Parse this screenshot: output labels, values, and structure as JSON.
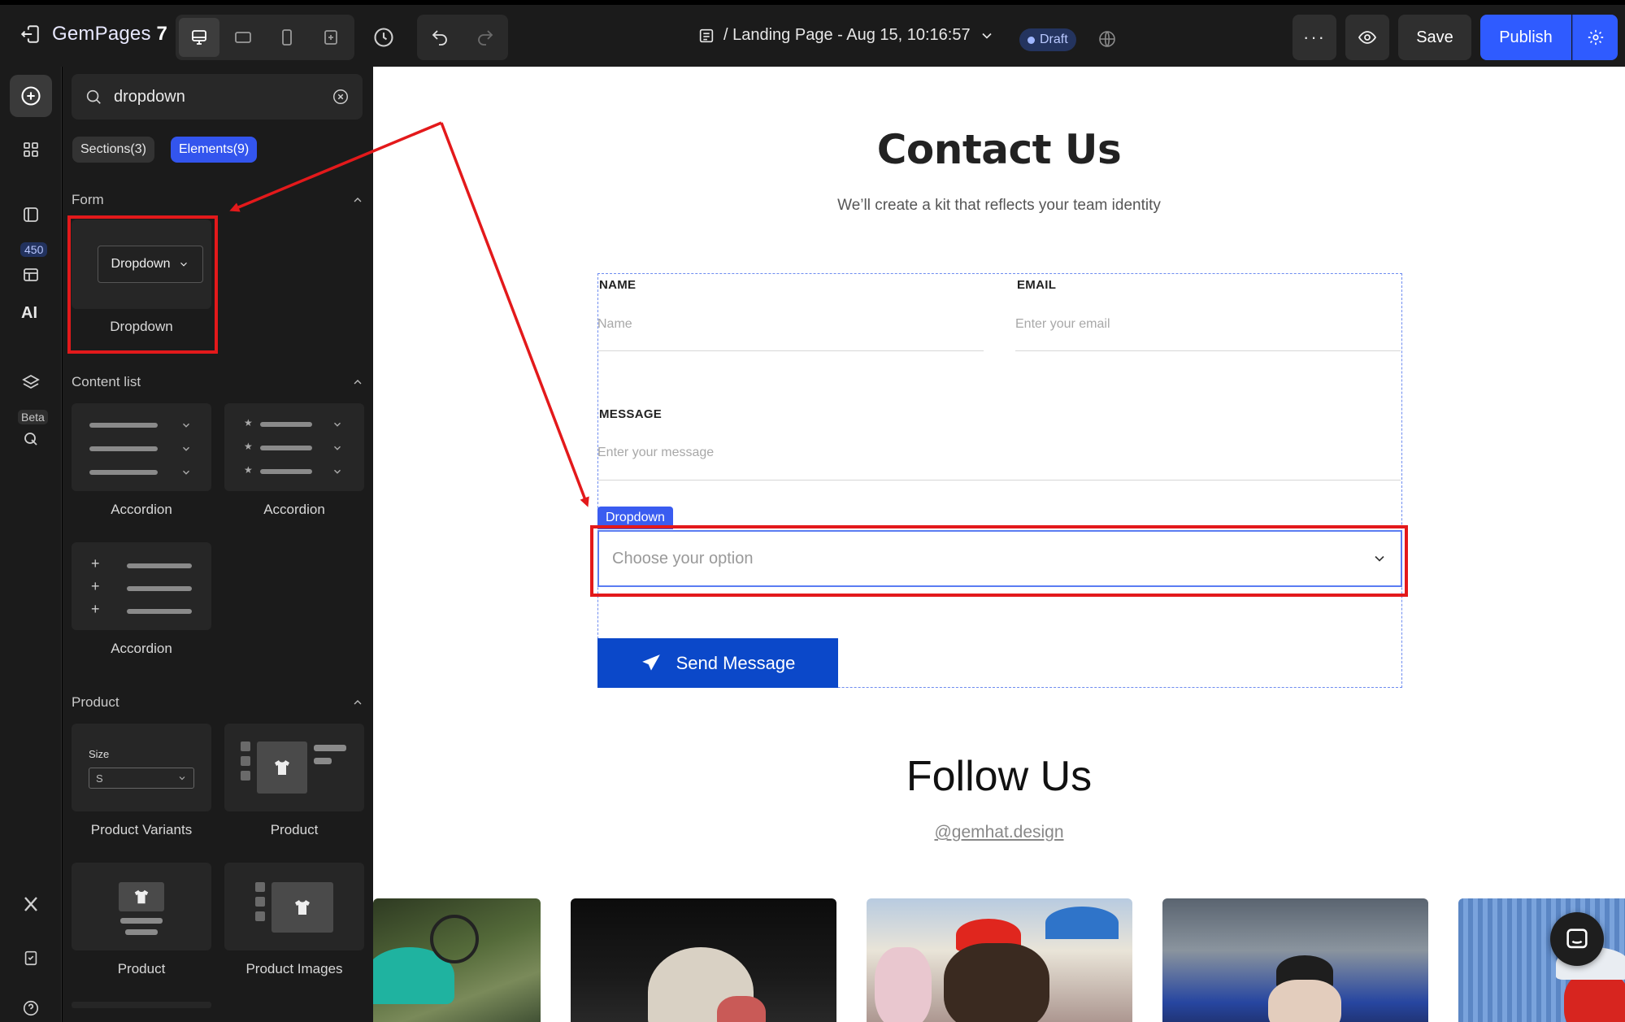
{
  "topbar": {
    "brand_name": "GemPages",
    "brand_version": "7",
    "page_title": "/ Landing Page - Aug 15, 10:16:57",
    "status": "Draft",
    "more_label": "···",
    "save_label": "Save",
    "publish_label": "Publish"
  },
  "rail": {
    "library_badge": "450",
    "ai_label": "AI",
    "beta_label": "Beta"
  },
  "panel": {
    "search": {
      "value": "dropdown",
      "placeholder": "Search"
    },
    "filters": {
      "sections": "Sections(3)",
      "elements": "Elements(9)"
    },
    "groups": {
      "form": {
        "title": "Form",
        "items": [
          {
            "label": "Dropdown",
            "preview_text": "Dropdown"
          }
        ]
      },
      "content_list": {
        "title": "Content list",
        "items": [
          {
            "label": "Accordion"
          },
          {
            "label": "Accordion"
          },
          {
            "label": "Accordion"
          }
        ]
      },
      "product": {
        "title": "Product",
        "items": [
          {
            "label": "Product Variants",
            "size_label": "Size",
            "size_value": "S"
          },
          {
            "label": "Product"
          },
          {
            "label": "Product"
          },
          {
            "label": "Product Images"
          }
        ]
      }
    }
  },
  "canvas": {
    "contact": {
      "title": "Contact Us",
      "subtitle": "We’ll create a kit that reflects your team identity",
      "name_label": "NAME",
      "name_placeholder": "Name",
      "email_label": "EMAIL",
      "email_placeholder": "Enter your email",
      "message_label": "MESSAGE",
      "message_placeholder": "Enter your message",
      "dropdown_tag": "Dropdown",
      "dropdown_placeholder": "Choose your option",
      "send_label": "Send Message"
    },
    "follow": {
      "title": "Follow Us",
      "handle": "@gemhat.design"
    }
  },
  "colors": {
    "accent": "#2f5bff",
    "send_button": "#0b48c9",
    "annotation": "#e3191b",
    "selection": "#3a5cf0"
  }
}
